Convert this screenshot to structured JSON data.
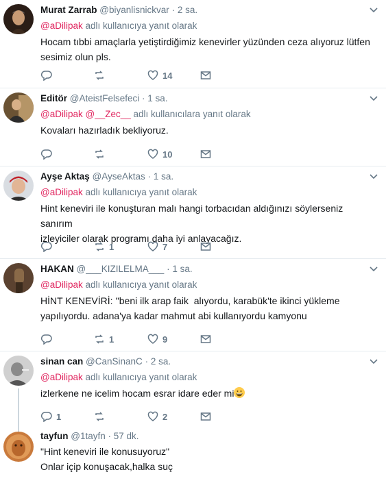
{
  "reply_prefix": "adlı kullanıcıya yanıt olarak",
  "reply_prefix_multi": "adlı kullanıcılara yanıt olarak",
  "colors": {
    "mention": "#e0245e",
    "muted": "#657786",
    "divider": "#e6ecf0"
  },
  "tweets": [
    {
      "name": "Murat Zarrab",
      "handle": "@biyanlisnickvar",
      "time": "2 sa.",
      "mentions": [
        "@aDilipak"
      ],
      "text": "Hocam tıbbi amaçlarla yetiştirdiğimiz kenevirler yüzünden ceza alıyoruz lütfen\nsesimiz olun pls.",
      "replies": "",
      "retweets": "",
      "likes": "14"
    },
    {
      "name": "Editör",
      "handle": "@AteistFelsefeci",
      "time": "1 sa.",
      "mentions": [
        "@aDilipak",
        "@__Zec__"
      ],
      "text": "Kovaları hazırladık bekliyoruz.",
      "replies": "",
      "retweets": "",
      "likes": "10"
    },
    {
      "name": "Ayşe Aktaş",
      "handle": "@AyseAktas",
      "time": "1 sa.",
      "mentions": [
        "@aDilipak"
      ],
      "text": "Hint keneviri ile konuşturan malı hangi torbacıdan aldığınızı söylerseniz sanırım\nizleyiciler olarak programı daha iyi anlayacağız.",
      "replies": "",
      "retweets": "1",
      "likes": "7"
    },
    {
      "name": "HAKAN",
      "handle": "@___KIZILELMA___",
      "time": "1 sa.",
      "mentions": [
        "@aDilipak"
      ],
      "text": "HİNT KENEVİRİ: ''beni ilk arap faik  alıyordu, karabük'te ikinci yükleme\nyapılıyordu. adana'ya kadar mahmut abi kullanıyordu kamyonu",
      "replies": "",
      "retweets": "1",
      "likes": "9"
    },
    {
      "name": "sinan can",
      "handle": "@CanSinanC",
      "time": "2 sa.",
      "mentions": [
        "@aDilipak"
      ],
      "text": "izlerkene ne icelim hocam esrar idare eder mi",
      "emoji": "grinning-face-emoji",
      "replies": "1",
      "retweets": "",
      "likes": "2"
    },
    {
      "name": "tayfun",
      "handle": "@1tayfn",
      "time": "57 dk.",
      "mentions": [],
      "text": "\"Hint keneviri ile konusuyoruz\"\nOnlar içip konuşacak,halka suç",
      "replies": "",
      "retweets": "",
      "likes": ""
    }
  ]
}
